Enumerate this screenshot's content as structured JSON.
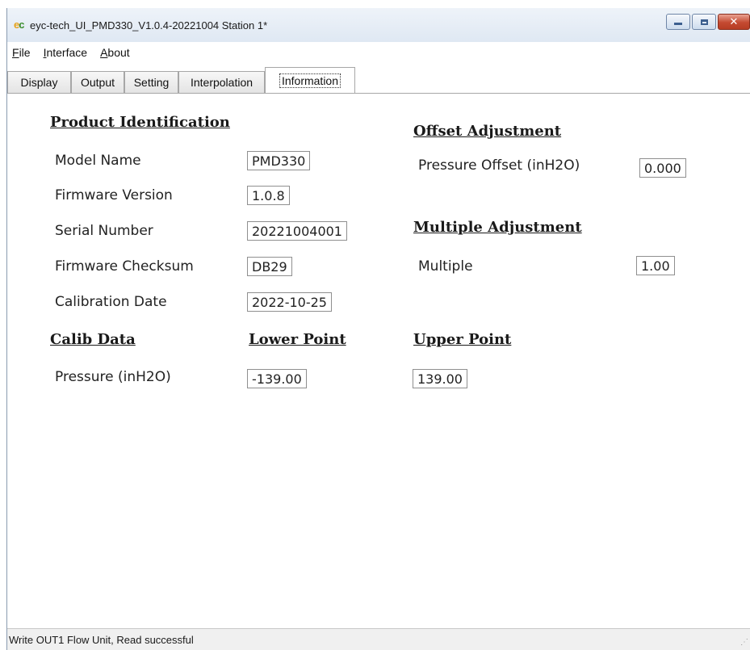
{
  "window": {
    "title": "eyc-tech_UI_PMD330_V1.0.4-20221004  Station 1*",
    "icon": "eyc-app-icon",
    "controls": {
      "minimize": "minimize-icon",
      "maximize": "maximize-icon",
      "close": "close-icon"
    }
  },
  "menu": {
    "items": [
      {
        "label": "File",
        "mnemonic": "F"
      },
      {
        "label": "Interface",
        "mnemonic": "I"
      },
      {
        "label": "About",
        "mnemonic": "A"
      }
    ]
  },
  "tabs": [
    {
      "label": "Display"
    },
    {
      "label": "Output"
    },
    {
      "label": "Setting"
    },
    {
      "label": "Interpolation"
    },
    {
      "label": "Information",
      "active": true
    }
  ],
  "product": {
    "heading": "Product Identification",
    "model_name_label": "Model Name",
    "model_name_value": "PMD330",
    "firmware_version_label": "Firmware Version",
    "firmware_version_value": "1.0.8",
    "serial_number_label": "Serial Number",
    "serial_number_value": "20221004001",
    "firmware_checksum_label": "Firmware Checksum",
    "firmware_checksum_value": "DB29",
    "calibration_date_label": "Calibration Date",
    "calibration_date_value": "2022-10-25"
  },
  "offset": {
    "heading": "Offset Adjustment",
    "pressure_offset_label": "Pressure Offset (inH2O)",
    "pressure_offset_value": "0.000"
  },
  "multiple": {
    "heading": "Multiple Adjustment",
    "multiple_label": "Multiple",
    "multiple_value": "1.00"
  },
  "calib": {
    "heading": "Calib Data",
    "lower_heading": "Lower Point",
    "upper_heading": "Upper Point",
    "pressure_label": "Pressure (inH2O)",
    "lower_value": "-139.00",
    "upper_value": "139.00"
  },
  "status": {
    "text": "Write OUT1 Flow Unit,   Read successful"
  }
}
